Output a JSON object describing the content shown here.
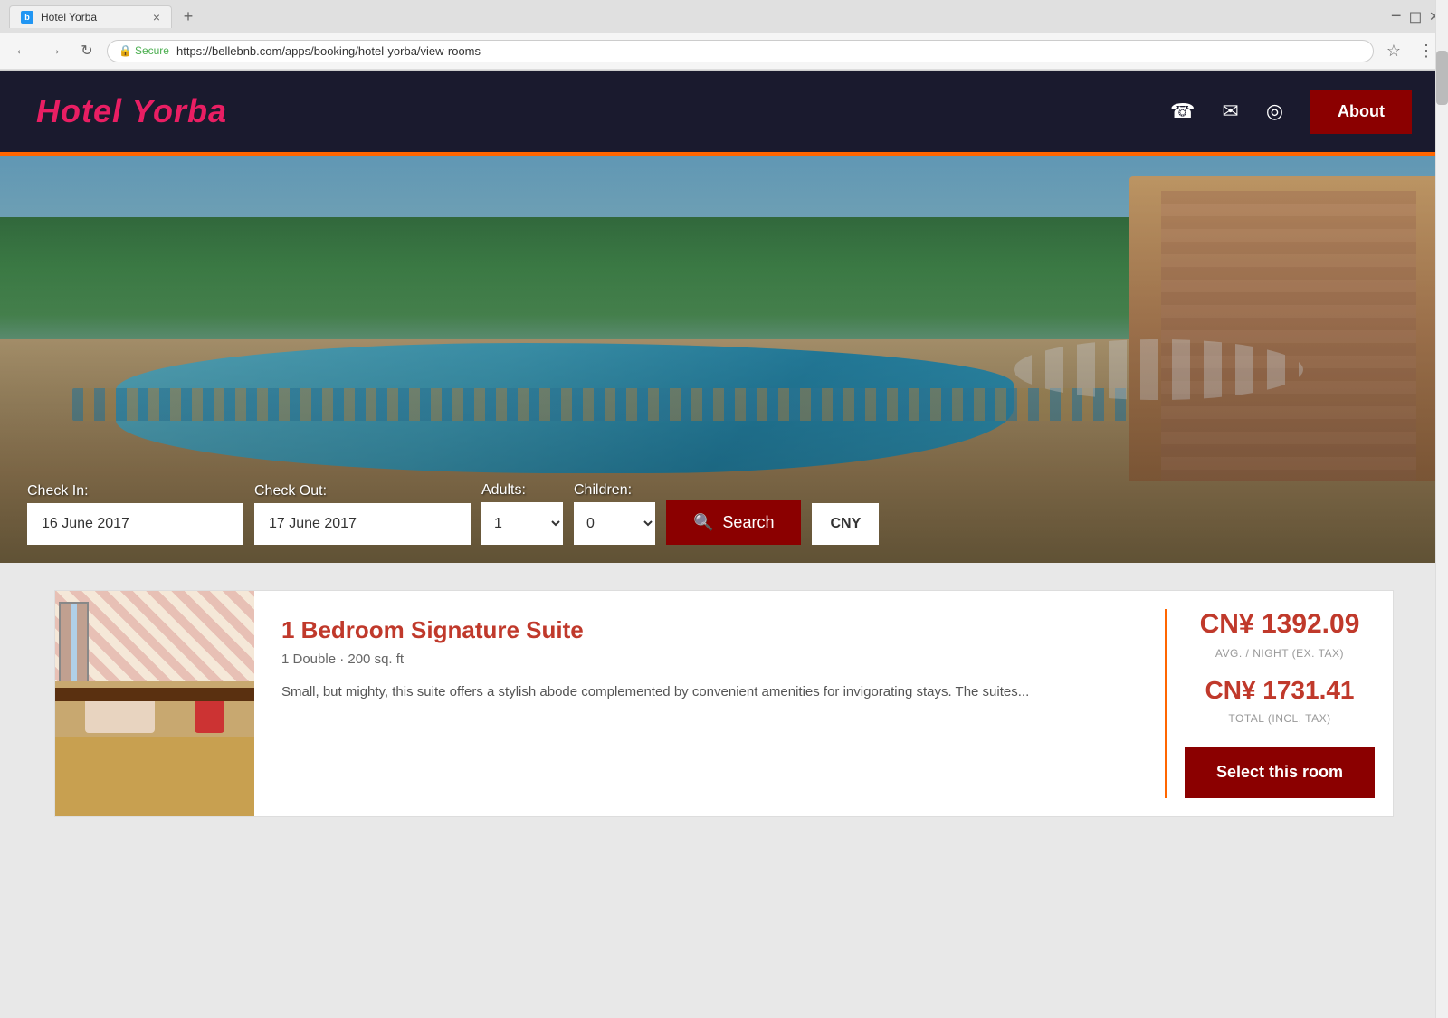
{
  "browser": {
    "tab_title": "Hotel Yorba",
    "tab_favicon": "b",
    "url_secure_label": "Secure",
    "url": "https://bellebnb.com/apps/booking/hotel-yorba/view-rooms",
    "currency_label": "CNY"
  },
  "header": {
    "logo": "Hotel Yorba",
    "nav_phone_icon": "☎",
    "nav_email_icon": "✉",
    "nav_map_icon": "◎",
    "about_label": "About"
  },
  "booking": {
    "checkin_label": "Check In:",
    "checkin_value": "16 June 2017",
    "checkout_label": "Check Out:",
    "checkout_value": "17 June 2017",
    "adults_label": "Adults:",
    "adults_value": "1",
    "children_label": "Children:",
    "children_value": "0",
    "search_label": "Search",
    "currency_label": "CNY"
  },
  "rooms": [
    {
      "name": "1 Bedroom Signature Suite",
      "meta": "1 Double · 200 sq. ft",
      "description": "Small, but mighty, this suite offers a stylish abode complemented by convenient amenities for invigorating stays. The suites...",
      "price_per_night": "CN¥ 1392.09",
      "price_per_night_label": "AVG. / NIGHT (EX. TAX)",
      "price_total": "CN¥ 1731.41",
      "price_total_label": "TOTAL (INCL. TAX)",
      "select_label": "Select this room"
    }
  ],
  "icons": {
    "search": "🔍",
    "phone": "☎",
    "email": "✉",
    "location": "◎",
    "back": "←",
    "forward": "→",
    "refresh": "↻",
    "star": "☆",
    "menu": "⋮",
    "lock": "🔒",
    "close": "×",
    "newtab": "+"
  },
  "colors": {
    "brand_red": "#c0392b",
    "dark_red": "#8B0000",
    "orange_accent": "#FF6600",
    "header_bg": "#1a1a2e",
    "card_bg": "#ffffff",
    "page_bg": "#e8e8e8"
  }
}
